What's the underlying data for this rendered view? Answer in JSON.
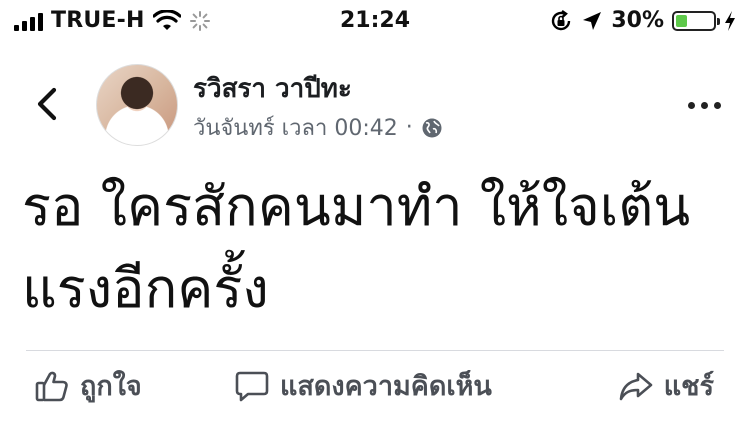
{
  "status_bar": {
    "carrier": "TRUE-H",
    "time": "21:24",
    "battery_percent": "30%",
    "battery_level": 0.3,
    "battery_color": "#5ec94a"
  },
  "post": {
    "author_name": "รวิสรา วาปีทะ",
    "timestamp": "วันจันทร์ เวลา 00:42",
    "separator": "·",
    "text_line_1": "รอ ใครสักคนมาทำ ให้ใจเต้น",
    "text_line_2": "แรงอีกครั้ง"
  },
  "actions": {
    "like_label": "ถูกใจ",
    "comment_label": "แสดงความคิดเห็น",
    "share_label": "แชร์"
  },
  "colors": {
    "meta_text": "#606770",
    "action_text": "#4b4f56"
  }
}
